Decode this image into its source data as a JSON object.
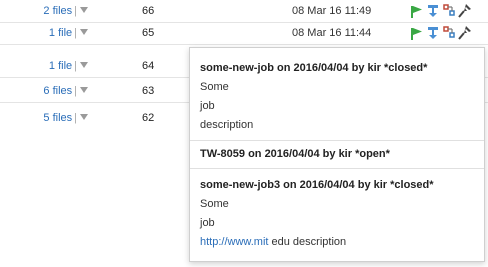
{
  "rows": [
    {
      "files": "2 files",
      "count": "66",
      "date": "08 Mar 16 11:49"
    },
    {
      "files": "1 file",
      "count": "65",
      "date": "08 Mar 16 11:44"
    },
    {
      "files": "1 file",
      "count": "64",
      "date": ""
    },
    {
      "files": "6 files",
      "count": "63",
      "date": ""
    },
    {
      "files": "5 files",
      "count": "62",
      "date": ""
    }
  ],
  "popup": {
    "entries": [
      {
        "title": "some-new-job on 2016/04/04 by kir *closed*",
        "lines": [
          "Some",
          "job",
          "description"
        ]
      },
      {
        "title": "TW-8059 on 2016/04/04 by kir *open*",
        "lines": []
      },
      {
        "title": "some-new-job3 on 2016/04/04 by kir *closed*",
        "lines": [
          "Some",
          "job"
        ],
        "link_text": "http://www.mit",
        "link_suffix": " edu description"
      }
    ]
  },
  "colors": {
    "link": "#2a6db8",
    "run_icon_green": "#3aa845",
    "download_icon_blue": "#4a8fd4",
    "pin_icon": "#444444"
  },
  "icons": [
    "run-icon",
    "download-icon",
    "changes-icon",
    "pin-icon"
  ]
}
